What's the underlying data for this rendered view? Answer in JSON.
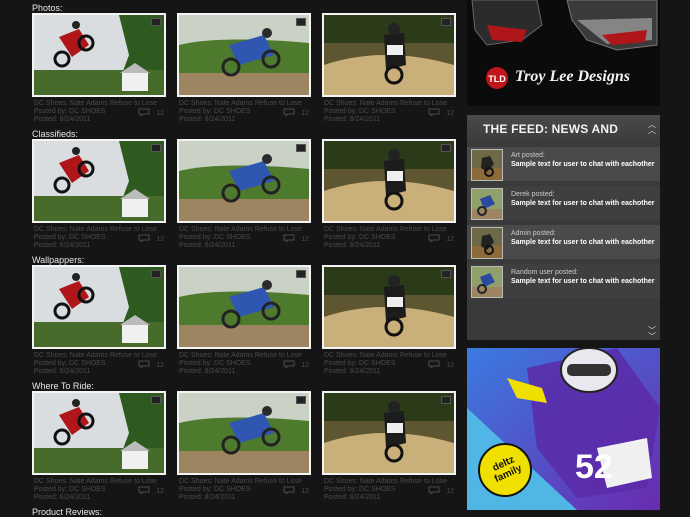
{
  "sections": [
    {
      "title": "Photos:"
    },
    {
      "title": "Classifieds:"
    },
    {
      "title": "Wallpappers:"
    },
    {
      "title": "Where To Ride:"
    },
    {
      "title": "Product Reviews:"
    }
  ],
  "card": {
    "title": "DC Shoes: Nate Adams Refuse to Lose",
    "posted_by": "Posted by:  DC SHOES",
    "posted": "Posted:  8/24/2011",
    "comments": "12"
  },
  "ad_top": {
    "brand": "Troy Lee Designs"
  },
  "feed": {
    "title": "THE FEED: NEWS AND EVENTS",
    "items": [
      {
        "who": "Art posted:",
        "msg": "Sample text for user to chat with eachother"
      },
      {
        "who": "Derek posted:",
        "msg": "Sample text for user to chat with eachother"
      },
      {
        "who": "Admin posted:",
        "msg": "Sample text for user to chat with eachother"
      },
      {
        "who": "Random user posted:",
        "msg": "Sample text for user to chat with eachother"
      }
    ]
  },
  "ad_bottom": {
    "brand": "deltz family",
    "number": "52"
  }
}
